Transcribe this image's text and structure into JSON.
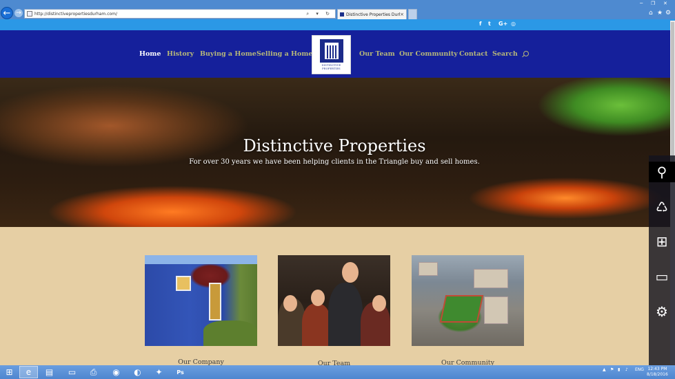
{
  "browser": {
    "url": "http://distinctivepropertiesdurham.com/",
    "tab_title": "Distinctive Properties Durha...",
    "tab_close": "×",
    "address_icons": "⌕ ▾ ↻",
    "window_controls": [
      "─",
      "❐",
      "✕"
    ],
    "toolbar_icons": [
      "⌂",
      "★",
      "⚙"
    ]
  },
  "social": {
    "icons": [
      "facebook-icon",
      "twitter-icon",
      "google-plus-icon",
      "rss-icon"
    ],
    "glyphs": [
      "f",
      "t",
      "G+",
      "◎"
    ]
  },
  "nav": {
    "items_left": [
      "Home",
      "History",
      "Buying a Home",
      "Selling a Home"
    ],
    "items_right": [
      "Our Team",
      "Our Community",
      "Contact",
      "Search"
    ],
    "active": "Home"
  },
  "logo": {
    "line1": "DISTINCTIVE",
    "line2": "PROPERTIES"
  },
  "hero": {
    "title": "Distinctive Properties",
    "subtitle": "For over 30 years we have been helping clients in the Triangle buy and sell homes."
  },
  "cards": [
    {
      "title": "Our Company"
    },
    {
      "title": "Our Team"
    },
    {
      "title": "Our Community"
    }
  ],
  "charms": {
    "icons": [
      "search-charm-icon",
      "share-charm-icon",
      "start-charm-icon",
      "devices-charm-icon",
      "settings-charm-icon"
    ],
    "glyphs": [
      "⚲",
      "♺",
      "⊞",
      "▭",
      "⚙"
    ]
  },
  "taskbar": {
    "items": [
      "start-icon",
      "ie-icon",
      "task-view-icon",
      "file-explorer-icon",
      "printer-icon",
      "chrome-icon",
      "firefox-icon",
      "network-app-icon",
      "photoshop-icon"
    ],
    "glyphs": [
      "⊞",
      "e",
      "▤",
      "▭",
      "⎙",
      "◉",
      "◐",
      "✦",
      "Ps"
    ],
    "tray_language": "ENG",
    "time": "12:43 PM",
    "date": "8/18/2016"
  },
  "colors": {
    "nav_bg": "#15209b",
    "topbar_bg": "#2b98e6",
    "nav_text": "#b7b879",
    "content_bg": "#e6cfa4"
  }
}
